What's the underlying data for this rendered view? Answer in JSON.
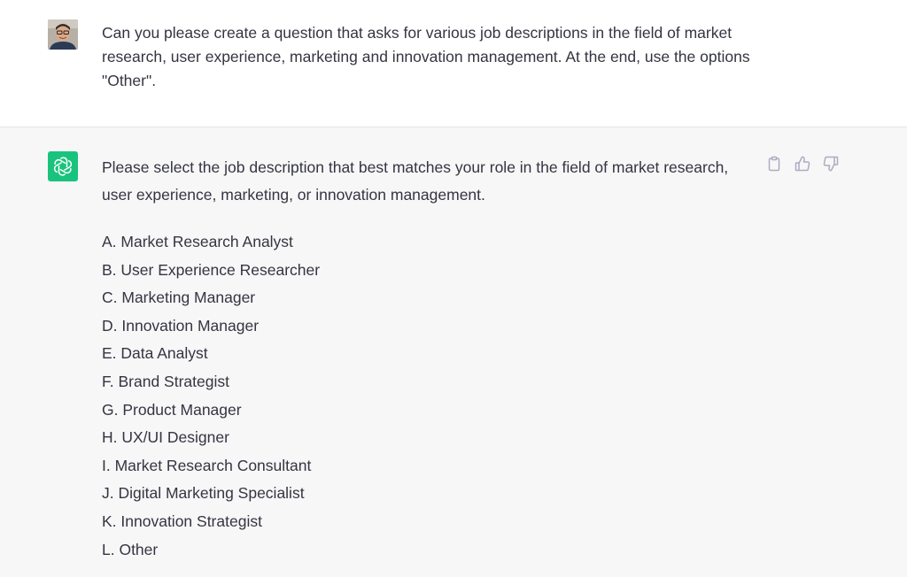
{
  "user_message": {
    "text": "Can you please create a question that asks for various job descriptions in the field of market research, user experience, marketing and innovation management. At the end, use the options \"Other\"."
  },
  "assistant_message": {
    "intro": "Please select the job description that best matches your role in the field of market research, user experience, marketing, or innovation management.",
    "options": [
      "A. Market Research Analyst",
      "B. User Experience Researcher",
      "C. Marketing Manager",
      "D. Innovation Manager",
      "E. Data Analyst",
      "F. Brand Strategist",
      "G. Product Manager",
      "H. UX/UI Designer",
      "I. Market Research Consultant",
      "J. Digital Marketing Specialist",
      "K. Innovation Strategist",
      "L. Other"
    ],
    "actions": [
      "clipboard-icon",
      "thumbs-up-icon",
      "thumbs-down-icon"
    ]
  },
  "colors": {
    "assistant_avatar_bg": "#19c37d",
    "assistant_bg": "#f7f7f8",
    "text": "#343541",
    "icon": "#acacbe"
  }
}
